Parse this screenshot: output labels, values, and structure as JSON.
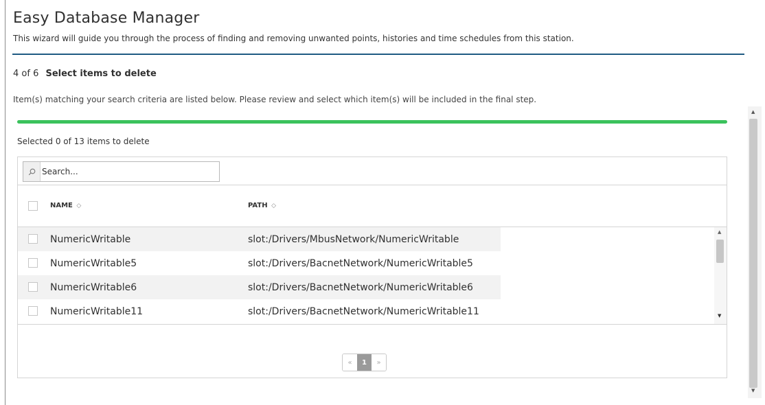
{
  "wizard": {
    "title": "Easy Database Manager",
    "subtitle": "This wizard will guide you through the process of finding and removing unwanted points, histories and time schedules from this station."
  },
  "step": {
    "count": "4 of 6",
    "name": "Select items to delete",
    "instructions": "Item(s) matching your search criteria are listed below. Please review and select which item(s) will be included in the final step.",
    "progress_fraction": 1.0
  },
  "selection": {
    "summary": "Selected 0 of 13 items to delete"
  },
  "search": {
    "placeholder": "Search..."
  },
  "table": {
    "columns": [
      "NAME",
      "PATH"
    ],
    "sort_glyph": "◇",
    "rows": [
      {
        "name": "NumericWritable",
        "path": "slot:/Drivers/MbusNetwork/NumericWritable",
        "checked": false
      },
      {
        "name": "NumericWritable5",
        "path": "slot:/Drivers/BacnetNetwork/NumericWritable5",
        "checked": false
      },
      {
        "name": "NumericWritable6",
        "path": "slot:/Drivers/BacnetNetwork/NumericWritable6",
        "checked": false
      },
      {
        "name": "NumericWritable11",
        "path": "slot:/Drivers/BacnetNetwork/NumericWritable11",
        "checked": false
      }
    ]
  },
  "pagination": {
    "prev": "«",
    "current": "1",
    "next": "»"
  },
  "colors": {
    "accent_rule": "#1e5a82",
    "progress": "#3bc25c",
    "pager_current": "#9a9a9a"
  },
  "icons": {
    "search": "search-icon",
    "scroll_up": "caret-up-icon",
    "scroll_down": "caret-down-icon"
  }
}
